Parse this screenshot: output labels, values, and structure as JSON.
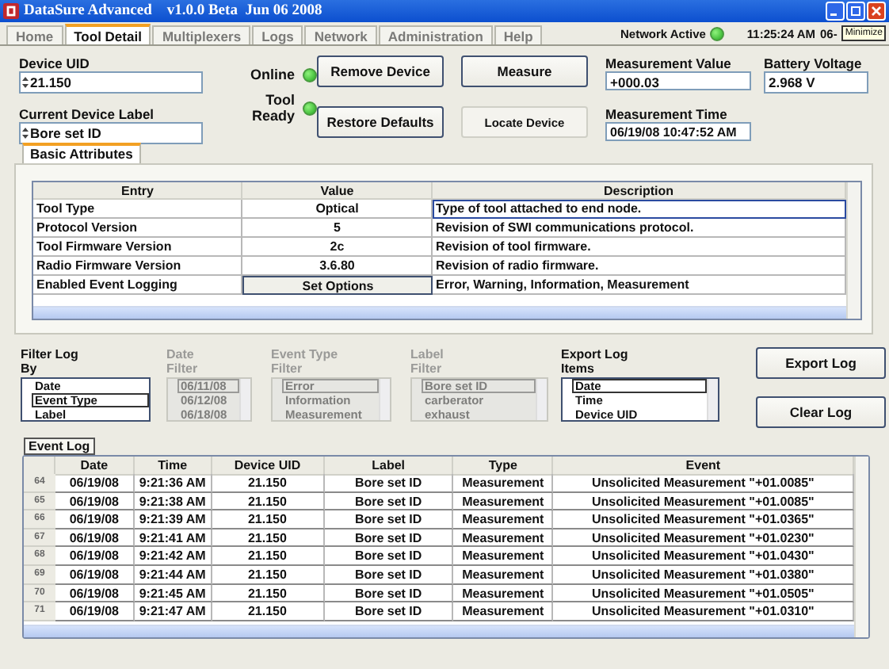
{
  "window": {
    "title": "DataSure Advanced    v1.0.0 Beta  Jun 06 2008",
    "tooltip": "Minimize"
  },
  "tabs": [
    {
      "label": "Home",
      "selected": false
    },
    {
      "label": "Tool Detail",
      "selected": true
    },
    {
      "label": "Multiplexers",
      "selected": false
    },
    {
      "label": "Logs",
      "selected": false
    },
    {
      "label": "Network",
      "selected": false
    },
    {
      "label": "Administration",
      "selected": false
    },
    {
      "label": "Help",
      "selected": false
    }
  ],
  "status": {
    "network_label": "Network Active",
    "network_on": true,
    "time": "11:25:24 AM",
    "date": "06-"
  },
  "device": {
    "uid_label": "Device UID",
    "uid": "21.150",
    "name_label": "Current Device Label",
    "name": "Bore set ID"
  },
  "indicators": [
    {
      "label": "Online",
      "on": true
    },
    {
      "label": "Tool Ready",
      "on": true
    }
  ],
  "buttons": [
    {
      "label": "Remove Device",
      "kind": "raised"
    },
    {
      "label": "Measure",
      "kind": "raised"
    },
    {
      "label": "Restore Defaults",
      "kind": "raised"
    },
    {
      "label": "Locate Device",
      "kind": "flat"
    }
  ],
  "readouts": [
    {
      "label": "Measurement Value",
      "value": "+000.03"
    },
    {
      "label": "Battery Voltage",
      "value": "2.968 V"
    },
    {
      "label": "Measurement Time",
      "value": "06/19/08 10:47:52 AM"
    }
  ],
  "attributes": {
    "tab": "Basic Attributes",
    "columns": [
      "Entry",
      "Value",
      "Description"
    ],
    "rows": [
      {
        "entry": "Tool Type",
        "value": "Optical",
        "description": "Type of tool attached to end node.",
        "kind": "text",
        "selected": true
      },
      {
        "entry": "Protocol Version",
        "value": "5",
        "description": "Revision of SWI communications protocol.",
        "kind": "text",
        "selected": false
      },
      {
        "entry": "Tool Firmware Version",
        "value": "2c",
        "description": "Revision of tool firmware.",
        "kind": "text",
        "selected": false
      },
      {
        "entry": "Radio Firmware Version",
        "value": "3.6.80",
        "description": "Revision of radio firmware.",
        "kind": "text",
        "selected": false
      },
      {
        "entry": "Enabled Event Logging",
        "value": "Set Options",
        "description": "Error, Warning, Information, Measurement",
        "kind": "button",
        "selected": false
      }
    ]
  },
  "filters": [
    {
      "label_lines": [
        "Filter Log",
        "By"
      ],
      "disabled": false,
      "items": [
        {
          "text": "Date",
          "selected": false
        },
        {
          "text": "Event Type",
          "selected": true
        },
        {
          "text": "Label",
          "selected": false
        }
      ]
    },
    {
      "label_lines": [
        "Date",
        "Filter"
      ],
      "disabled": true,
      "items": [
        {
          "text": "06/11/08",
          "selected": true
        },
        {
          "text": "06/12/08",
          "selected": false
        },
        {
          "text": "06/18/08",
          "selected": false
        }
      ]
    },
    {
      "label_lines": [
        "Event Type",
        "Filter"
      ],
      "disabled": true,
      "items": [
        {
          "text": "Error",
          "selected": true
        },
        {
          "text": "Information",
          "selected": false
        },
        {
          "text": "Measurement",
          "selected": false
        }
      ]
    },
    {
      "label_lines": [
        "Label",
        "Filter"
      ],
      "disabled": true,
      "items": [
        {
          "text": "Bore set ID",
          "selected": true
        },
        {
          "text": "carberator",
          "selected": false
        },
        {
          "text": "exhaust",
          "selected": false
        }
      ]
    },
    {
      "label_lines": [
        "Export Log",
        "Items"
      ],
      "disabled": false,
      "items": [
        {
          "text": "Date",
          "selected": true
        },
        {
          "text": "Time",
          "selected": false
        },
        {
          "text": "Device UID",
          "selected": false
        }
      ]
    }
  ],
  "actions": [
    "Export Log",
    "Clear Log"
  ],
  "event_log": {
    "tab": "Event Log",
    "columns": [
      "Date",
      "Time",
      "Device UID",
      "Label",
      "Type",
      "Event"
    ],
    "rows": [
      {
        "num": "64",
        "cells": [
          "06/19/08",
          "9:21:36 AM",
          "21.150",
          "Bore set ID",
          "Measurement",
          "Unsolicited Measurement \"+01.0085\""
        ]
      },
      {
        "num": "65",
        "cells": [
          "06/19/08",
          "9:21:38 AM",
          "21.150",
          "Bore set ID",
          "Measurement",
          "Unsolicited Measurement \"+01.0085\""
        ]
      },
      {
        "num": "66",
        "cells": [
          "06/19/08",
          "9:21:39 AM",
          "21.150",
          "Bore set ID",
          "Measurement",
          "Unsolicited Measurement \"+01.0365\""
        ]
      },
      {
        "num": "67",
        "cells": [
          "06/19/08",
          "9:21:41 AM",
          "21.150",
          "Bore set ID",
          "Measurement",
          "Unsolicited Measurement \"+01.0230\""
        ]
      },
      {
        "num": "68",
        "cells": [
          "06/19/08",
          "9:21:42 AM",
          "21.150",
          "Bore set ID",
          "Measurement",
          "Unsolicited Measurement \"+01.0430\""
        ]
      },
      {
        "num": "69",
        "cells": [
          "06/19/08",
          "9:21:44 AM",
          "21.150",
          "Bore set ID",
          "Measurement",
          "Unsolicited Measurement \"+01.0380\""
        ]
      },
      {
        "num": "70",
        "cells": [
          "06/19/08",
          "9:21:45 AM",
          "21.150",
          "Bore set ID",
          "Measurement",
          "Unsolicited Measurement \"+01.0505\""
        ]
      },
      {
        "num": "71",
        "cells": [
          "06/19/08",
          "9:21:47 AM",
          "21.150",
          "Bore set ID",
          "Measurement",
          "Unsolicited Measurement \"+01.0310\""
        ]
      }
    ]
  }
}
